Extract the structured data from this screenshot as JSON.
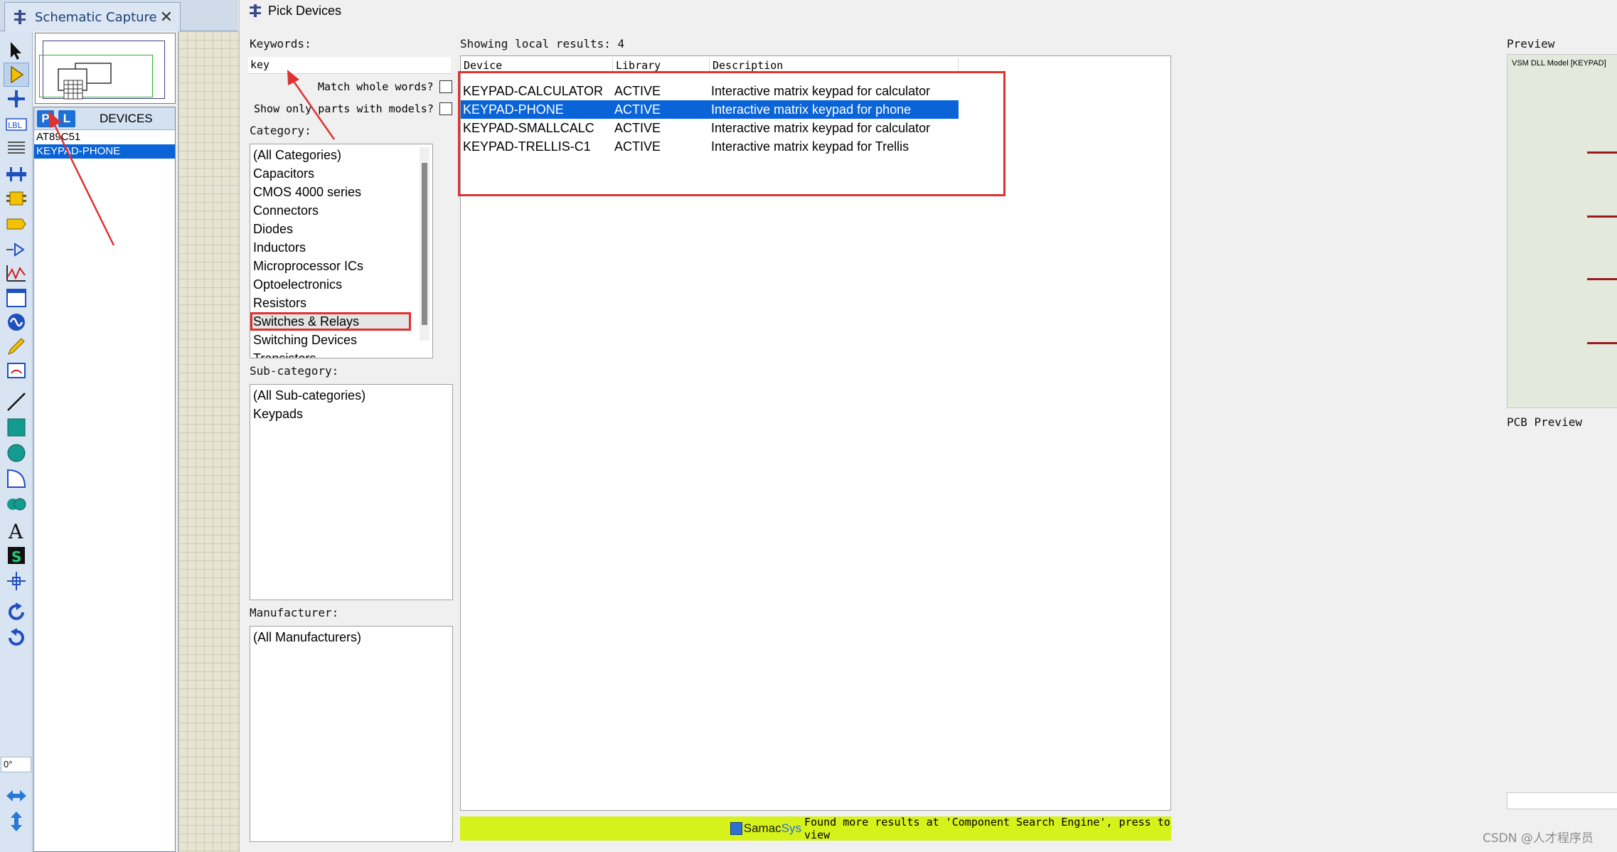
{
  "capture_tab": {
    "title": "Schematic Capture",
    "close": "✕"
  },
  "devices_panel": {
    "p_label": "P",
    "l_label": "L",
    "header": "DEVICES",
    "items": [
      "AT89C51",
      "KEYPAD-PHONE"
    ]
  },
  "toolbar": {
    "angle": "0°"
  },
  "dialog": {
    "title": "Pick Devices",
    "keywords_label": "Keywords:",
    "keyword_value": "key",
    "match_whole_words": "Match whole words?",
    "show_only_models": "Show only parts with models?",
    "category_label": "Category:",
    "categories": [
      "(All Categories)",
      "Capacitors",
      "CMOS 4000 series",
      "Connectors",
      "Diodes",
      "Inductors",
      "Microprocessor ICs",
      "Optoelectronics",
      "Resistors",
      "Switches & Relays",
      "Switching Devices",
      "Transistors"
    ],
    "subcategory_label": "Sub-category:",
    "subcategories": [
      "(All Sub-categories)",
      "Keypads"
    ],
    "manufacturer_label": "Manufacturer:",
    "manufacturers": [
      "(All Manufacturers)"
    ],
    "results_summary": "Showing local results: 4",
    "columns": [
      "Device",
      "Library",
      "Description"
    ],
    "results": [
      {
        "device": "KEYPAD-CALCULATOR",
        "library": "ACTIVE",
        "description": "Interactive matrix keypad for calculator"
      },
      {
        "device": "KEYPAD-PHONE",
        "library": "ACTIVE",
        "description": "Interactive matrix keypad for phone"
      },
      {
        "device": "KEYPAD-SMALLCALC",
        "library": "ACTIVE",
        "description": "Interactive matrix keypad for calculator"
      },
      {
        "device": "KEYPAD-TRELLIS-C1",
        "library": "ACTIVE",
        "description": "Interactive matrix keypad for Trellis"
      }
    ],
    "preview_label": "Preview",
    "preview_model": "VSM DLL Model [KEYPAD]",
    "pcb_preview_label": "PCB Preview",
    "samacsys_brand_a": "Samac",
    "samacsys_brand_b": "Sys",
    "samacsys_message": "Found more results at 'Component Search Engine', press to view"
  },
  "watermark": "CSDN @人才程序员",
  "colors": {
    "selection": "#0a64d8",
    "annotation": "#e03131",
    "samacsys_bar": "#d5f21a"
  }
}
